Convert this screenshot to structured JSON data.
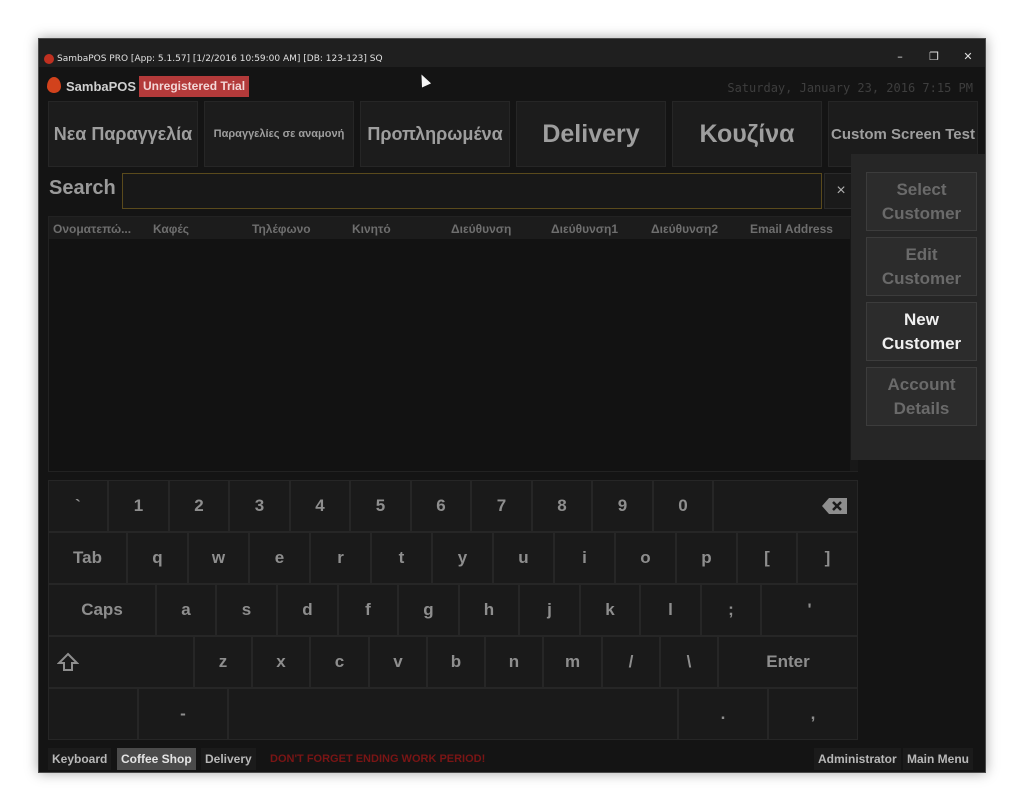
{
  "window": {
    "title": "SambaPOS PRO [App: 5.1.57] [1/2/2016 10:59:00 AM] [DB: 123-123] SQ",
    "controls": {
      "minimize": "–",
      "maximize": "❐",
      "close": "✕"
    }
  },
  "header": {
    "logo": "SambaPOS",
    "badge": "Unregistered Trial",
    "datetime": "Saturday, January 23, 2016 7:15 PM"
  },
  "nav": [
    "Νεα Παραγγελία",
    "Παραγγελίες σε αναμονή",
    "Προπληρωμένα",
    "Delivery",
    "Κουζίνα",
    "Custom Screen Test"
  ],
  "search": {
    "label": "Search",
    "value": "",
    "clear": "×"
  },
  "table": {
    "columns": [
      "Ονοματεπώ...",
      "Καφές",
      "Τηλέφωνο",
      "Κινητό",
      "Διεύθυνση",
      "Διεύθυνση1",
      "Διεύθυνση2",
      "Email Address"
    ]
  },
  "side_buttons": {
    "select_line1": "Select",
    "select_line2": "Customer",
    "edit_line1": "Edit",
    "edit_line2": "Customer",
    "new_line1": "New",
    "new_line2": "Customer",
    "account_line1": "Account",
    "account_line2": "Details"
  },
  "keyboard": {
    "row1": [
      "`",
      "1",
      "2",
      "3",
      "4",
      "5",
      "6",
      "7",
      "8",
      "9",
      "0"
    ],
    "row2": [
      "Tab",
      "q",
      "w",
      "e",
      "r",
      "t",
      "y",
      "u",
      "i",
      "o",
      "p",
      "[",
      "]"
    ],
    "row3": [
      "Caps",
      "a",
      "s",
      "d",
      "f",
      "g",
      "h",
      "j",
      "k",
      "l",
      ";",
      "'"
    ],
    "row4": [
      "z",
      "x",
      "c",
      "v",
      "b",
      "n",
      "m",
      "/",
      "\\",
      "Enter"
    ],
    "row5": [
      "-",
      ".",
      ","
    ],
    "backspace_icon": "backspace-icon",
    "shift_icon": "shift-icon"
  },
  "statusbar": {
    "keyboard": "Keyboard",
    "coffee_shop": "Coffee Shop",
    "delivery": "Delivery",
    "warning": "DON'T FORGET ENDING WORK PERIOD!",
    "user": "Administrator",
    "main_menu": "Main Menu"
  },
  "colors": {
    "background": "#141414",
    "badge": "#b33a3a",
    "warning": "#7a1515",
    "search_border": "#5a4a1c"
  }
}
